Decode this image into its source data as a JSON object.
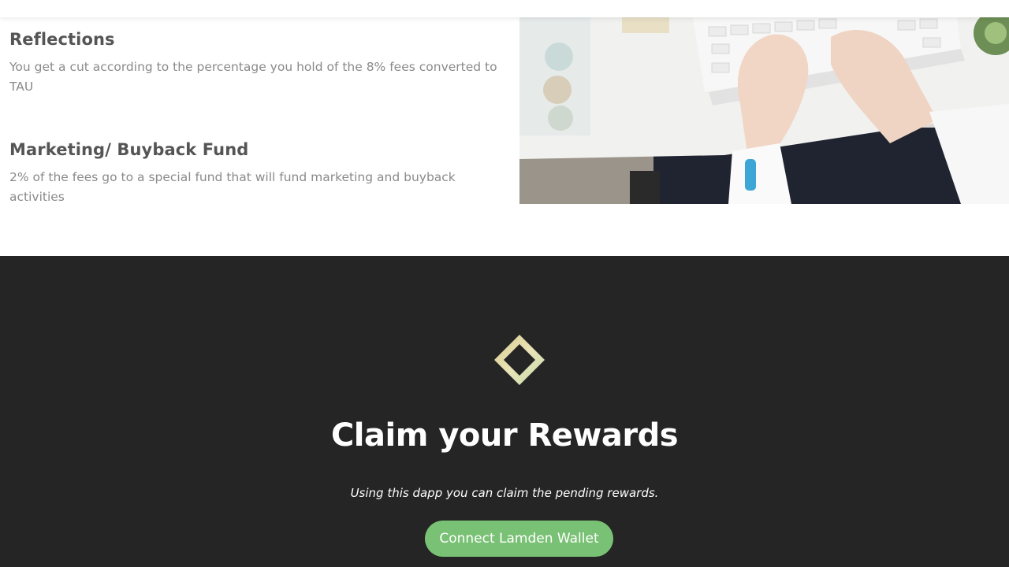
{
  "features": [
    {
      "title": "Reflections",
      "text": "You get a cut according to the percentage you hold of the 8% fees converted to TAU"
    },
    {
      "title": "Marketing/ Buyback Fund",
      "text": "2% of the fees go to a special fund that will fund marketing and buyback activities"
    }
  ],
  "claim": {
    "title": "Claim your Rewards",
    "subtitle": "Using this dapp you can claim the pending rewards.",
    "button_label": "Connect Lamden Wallet"
  },
  "colors": {
    "dark_background": "#252525",
    "button_green": "#79c174",
    "heading_gray": "#555555",
    "body_gray": "#8a8a8a"
  },
  "icons": {
    "logo": "diamond-logo-icon"
  }
}
